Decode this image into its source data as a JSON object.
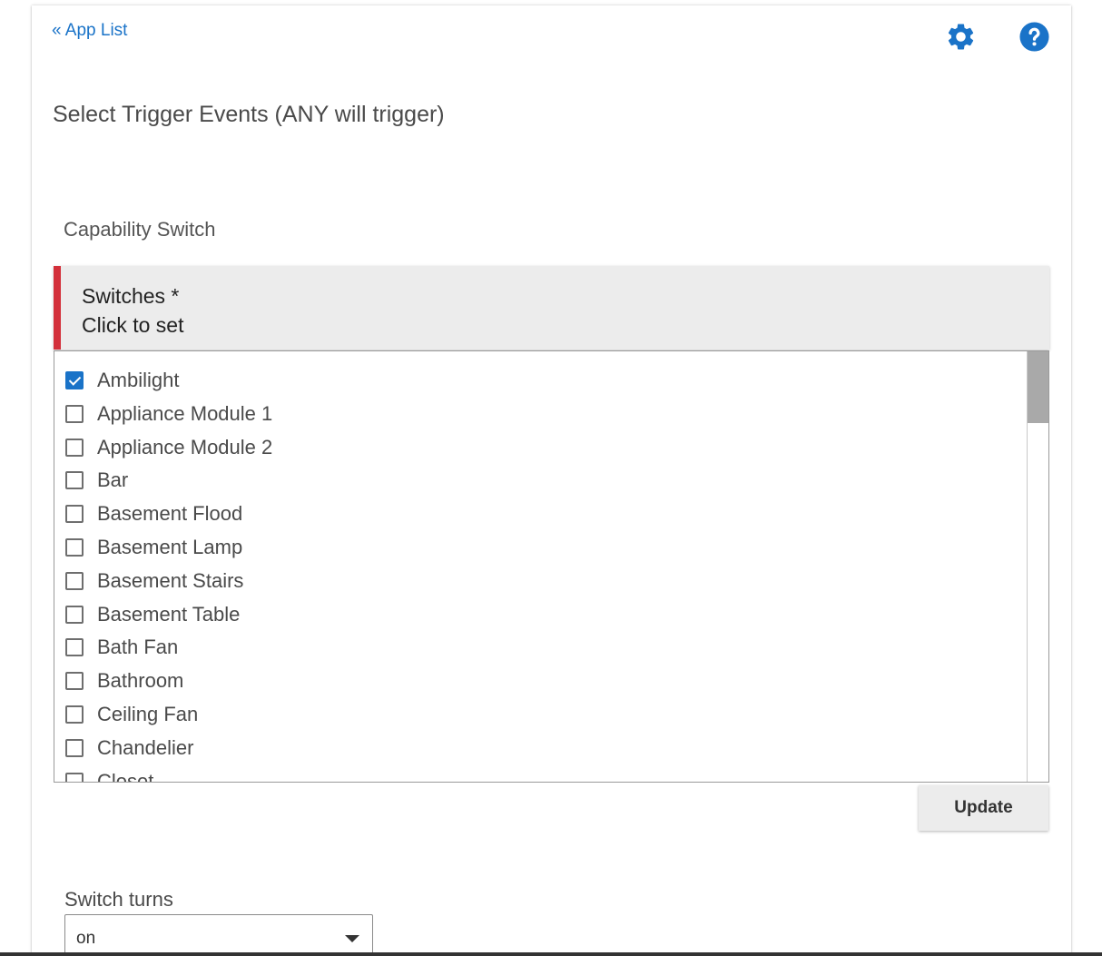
{
  "nav": {
    "back_link": "« App List",
    "settings_icon": "gear-icon",
    "help_icon": "help-icon",
    "accent_color": "#1a73c8"
  },
  "page": {
    "title": "Select Trigger Events (ANY will trigger)"
  },
  "capability": {
    "label": "Capability Switch"
  },
  "switches": {
    "title": "Switches *",
    "subtitle": "Click to set",
    "required_color": "#d32f3a",
    "items": [
      {
        "label": "Ambilight",
        "checked": true
      },
      {
        "label": "Appliance Module 1",
        "checked": false
      },
      {
        "label": "Appliance Module 2",
        "checked": false
      },
      {
        "label": "Bar",
        "checked": false
      },
      {
        "label": "Basement Flood",
        "checked": false
      },
      {
        "label": "Basement Lamp",
        "checked": false
      },
      {
        "label": "Basement Stairs",
        "checked": false
      },
      {
        "label": "Basement Table",
        "checked": false
      },
      {
        "label": "Bath Fan",
        "checked": false
      },
      {
        "label": "Bathroom",
        "checked": false
      },
      {
        "label": "Ceiling Fan",
        "checked": false
      },
      {
        "label": "Chandelier",
        "checked": false
      },
      {
        "label": "Closet",
        "checked": false
      }
    ]
  },
  "update_button": {
    "label": "Update"
  },
  "switch_turns": {
    "label": "Switch turns",
    "selected": "on"
  }
}
